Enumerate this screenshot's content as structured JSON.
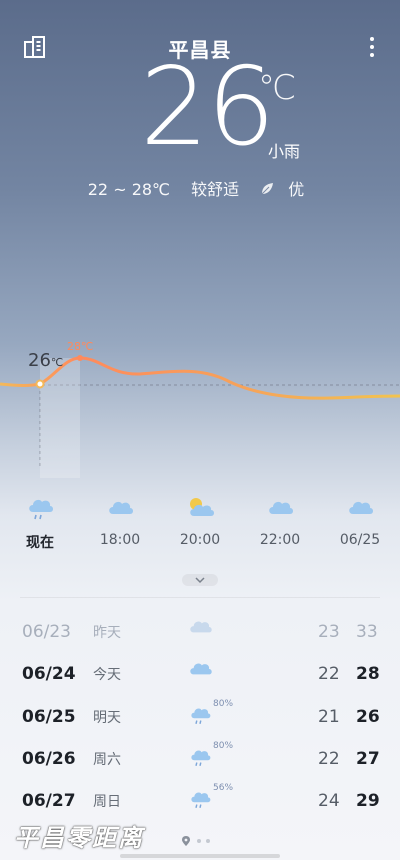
{
  "header": {
    "city": "平昌县",
    "temperature": "26",
    "unit": "℃",
    "condition": "小雨",
    "range": "22 ~ 28℃",
    "comfort": "较舒适",
    "air_quality": "优"
  },
  "curve": {
    "now_temp": "26",
    "now_unit": "℃",
    "peak_label": "28℃"
  },
  "hourly": [
    {
      "label": "现在",
      "icon": "rain-cloud-icon"
    },
    {
      "label": "18:00",
      "icon": "cloud-icon"
    },
    {
      "label": "20:00",
      "icon": "partly-sunny-icon"
    },
    {
      "label": "22:00",
      "icon": "cloud-icon"
    },
    {
      "label": "06/25",
      "icon": "cloud-icon"
    }
  ],
  "daily": [
    {
      "date": "06/23",
      "weekday": "昨天",
      "icon": "cloud-icon",
      "pop": "",
      "low": "23",
      "high": "33"
    },
    {
      "date": "06/24",
      "weekday": "今天",
      "icon": "cloud-icon",
      "pop": "",
      "low": "22",
      "high": "28"
    },
    {
      "date": "06/25",
      "weekday": "明天",
      "icon": "rain-cloud-icon",
      "pop": "80%",
      "low": "21",
      "high": "26"
    },
    {
      "date": "06/26",
      "weekday": "周六",
      "icon": "rain-cloud-icon",
      "pop": "80%",
      "low": "22",
      "high": "27"
    },
    {
      "date": "06/27",
      "weekday": "周日",
      "icon": "rain-cloud-icon",
      "pop": "56%",
      "low": "24",
      "high": "29"
    }
  ],
  "watermark": "平昌零距离",
  "colors": {
    "curve_warm": "#ff8a5c",
    "curve_cool": "#f2c34f",
    "cloud": "#9bc7ef"
  }
}
